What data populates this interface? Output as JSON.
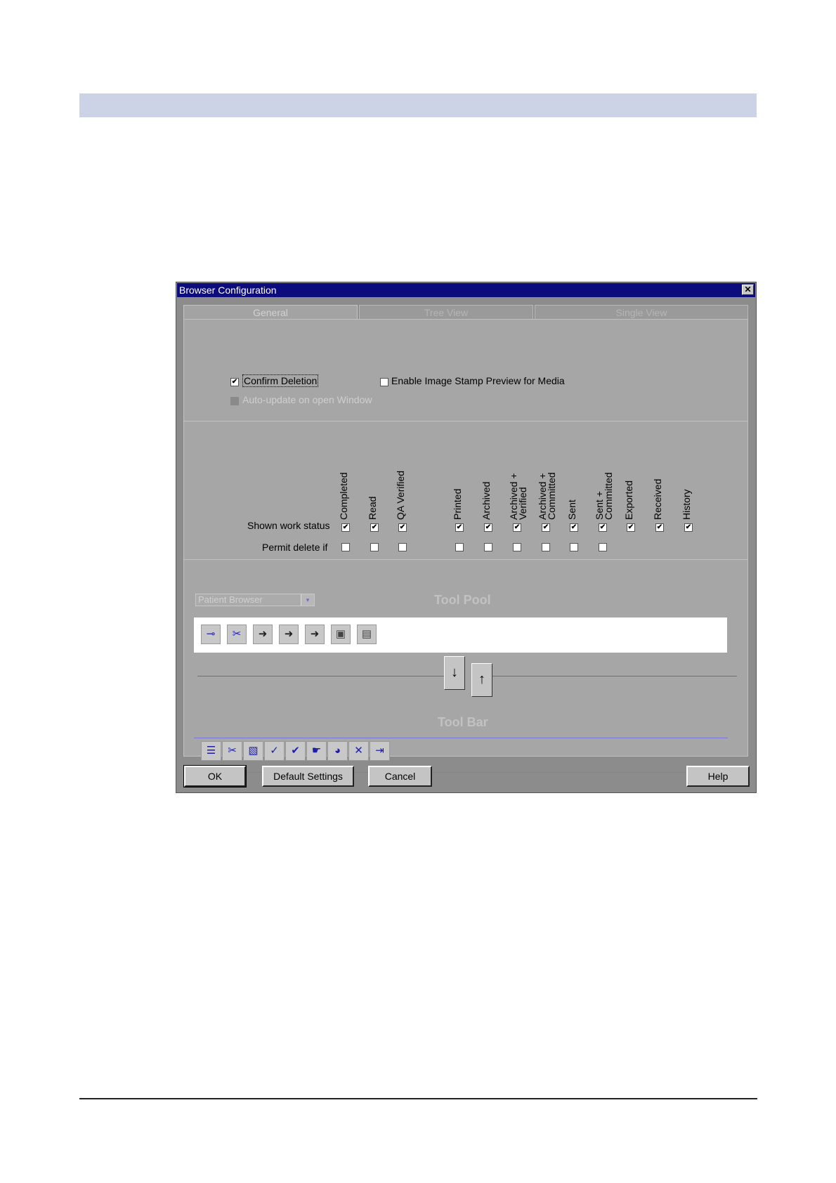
{
  "dialog": {
    "title": "Browser Configuration",
    "close_glyph": "✕"
  },
  "tabs": [
    {
      "label": "General",
      "active": true
    },
    {
      "label": "Tree View",
      "active": false
    },
    {
      "label": "Single View",
      "active": false
    }
  ],
  "general": {
    "confirm_deletion": {
      "label": "Confirm Deletion",
      "checked": true
    },
    "enable_stamp": {
      "label": "Enable Image Stamp Preview for Media",
      "checked": false
    },
    "auto_update": {
      "label": "Auto-update on open Window",
      "checked": false,
      "disabled": true
    }
  },
  "status_table": {
    "columns": [
      "Completed",
      "Read",
      "QA Verified",
      "Printed",
      "Archived",
      "Archived + Verified",
      "Archived + Committed",
      "Sent",
      "Sent + Committed",
      "Exported",
      "Received",
      "History"
    ],
    "rows": [
      {
        "label": "Shown work status",
        "values": [
          true,
          true,
          true,
          true,
          true,
          true,
          true,
          true,
          true,
          true,
          true,
          true
        ]
      },
      {
        "label": "Permit delete if",
        "values": [
          false,
          false,
          false,
          false,
          false,
          false,
          false,
          false,
          false,
          null,
          null,
          null
        ]
      }
    ],
    "check_glyph": "✔"
  },
  "tool_pool": {
    "title": "Tool Pool",
    "browser_select": "Patient Browser",
    "dropdown_glyph": "▾",
    "icons": [
      {
        "name": "key-icon",
        "glyph": "⊸",
        "accent": "#2020b8"
      },
      {
        "name": "unlock-key-icon",
        "glyph": "✂",
        "accent": "#2020b8"
      },
      {
        "name": "import-icon",
        "glyph": "➜",
        "accent": "#222222"
      },
      {
        "name": "import-box-icon",
        "glyph": "➜",
        "accent": "#222222"
      },
      {
        "name": "import-device-icon",
        "glyph": "➜",
        "accent": "#222222"
      },
      {
        "name": "network-node-icon",
        "glyph": "▣",
        "accent": "#444444"
      },
      {
        "name": "computer-icon",
        "glyph": "▤",
        "accent": "#444444"
      }
    ],
    "down_arrow_glyph": "↓",
    "up_arrow_glyph": "↑"
  },
  "tool_bar": {
    "title": "Tool Bar",
    "icons": [
      {
        "name": "list-tree-icon",
        "glyph": "☰"
      },
      {
        "name": "scissors-icon",
        "glyph": "✂"
      },
      {
        "name": "paste-icon",
        "glyph": "▧"
      },
      {
        "name": "folder-check-icon",
        "glyph": "✓"
      },
      {
        "name": "folder-double-check-icon",
        "glyph": "✔"
      },
      {
        "name": "folder-hand-icon",
        "glyph": "☛"
      },
      {
        "name": "globe-icon",
        "glyph": "◕"
      },
      {
        "name": "delete-cross-icon",
        "glyph": "✕"
      },
      {
        "name": "export-doc-icon",
        "glyph": "⇥"
      }
    ]
  },
  "buttons": {
    "ok": "OK",
    "defaults": "Default Settings",
    "cancel": "Cancel",
    "help": "Help"
  }
}
